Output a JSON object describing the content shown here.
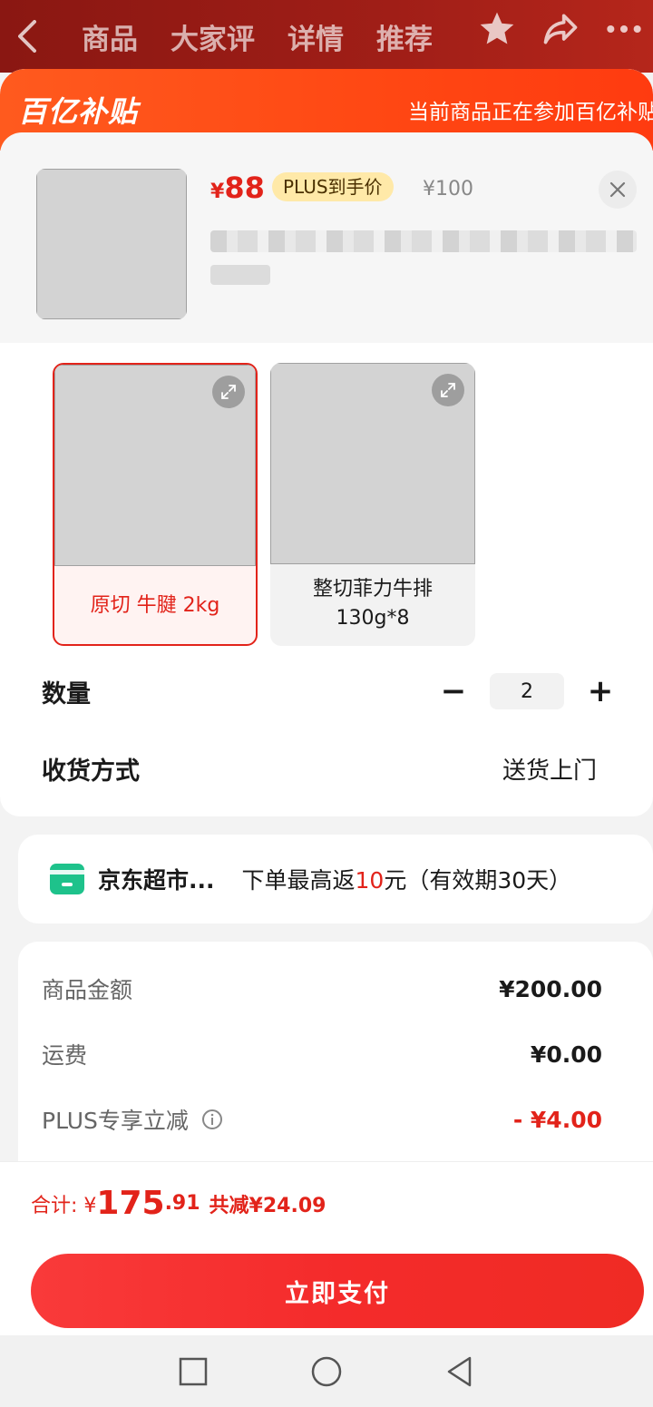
{
  "nav": {
    "tabs": [
      "商品",
      "大家评",
      "详情",
      "推荐"
    ]
  },
  "banner": {
    "logo": "百亿补贴",
    "note": "当前商品正在参加百亿补贴"
  },
  "product": {
    "price_symbol": "¥",
    "price": "88",
    "plus_tag": "PLUS到手价",
    "original_price": "¥100"
  },
  "specs": [
    {
      "label": "原切 牛腱 2kg",
      "selected": true
    },
    {
      "label": "整切菲力牛排 130g*8",
      "selected": false
    }
  ],
  "quantity": {
    "label": "数量",
    "value": "2",
    "minus": "−",
    "plus": "+"
  },
  "delivery": {
    "label": "收货方式",
    "value": "送货上门"
  },
  "promo": {
    "name": "京东超市...",
    "desc_prefix": "下单最高返",
    "desc_amount": "10",
    "desc_suffix": "元（有效期30天）"
  },
  "summary": {
    "goods_label": "商品金额",
    "goods_value": "¥200.00",
    "shipping_label": "运费",
    "shipping_value": "¥0.00",
    "plus_label": "PLUS专享立减",
    "plus_value": "- ¥4.00"
  },
  "total": {
    "label": "合计: ¥",
    "int": "175",
    "dec": ".91",
    "cut": "共减¥24.09"
  },
  "pay_button": "立即支付",
  "colors": {
    "accent": "#e2231a",
    "banner": "#ff4713",
    "nav_bg": "#a01e17"
  }
}
